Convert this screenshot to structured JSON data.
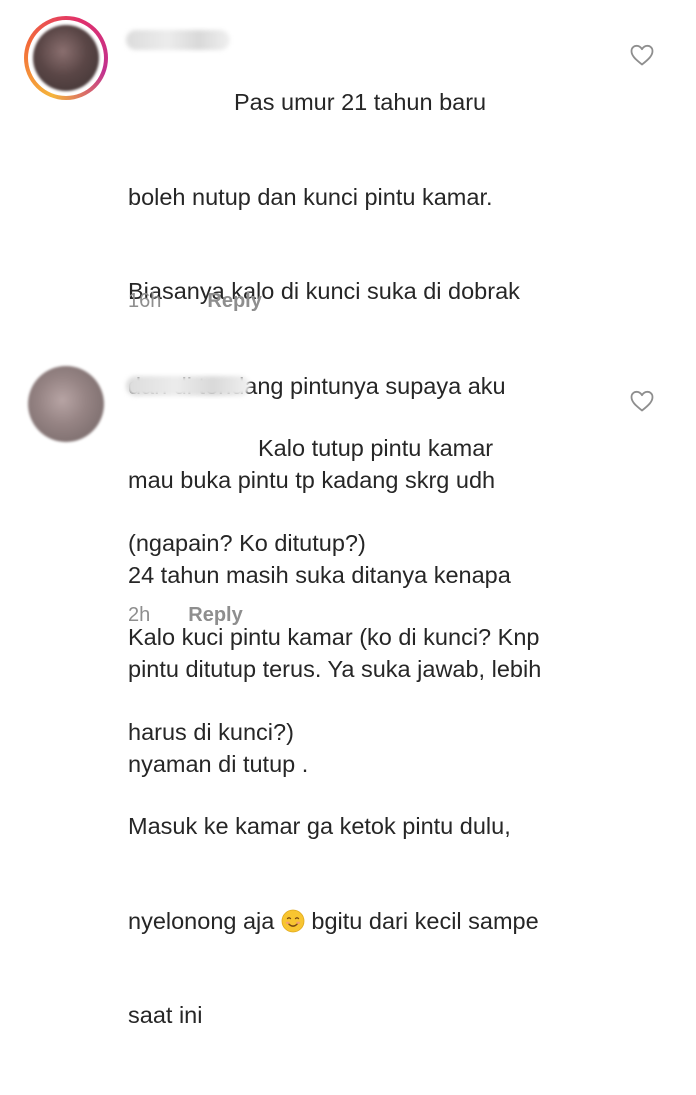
{
  "comments": [
    {
      "text_lines": [
        "Pas umur 21 tahun baru",
        "boleh nutup dan kunci pintu kamar.",
        "Biasanya kalo di kunci suka di dobrak",
        "dan di tendang pintunya supaya aku",
        "mau buka pintu tp kadang skrg udh",
        "24 tahun masih suka ditanya kenapa",
        "pintu ditutup terus. Ya suka jawab, lebih",
        "nyaman di tutup ."
      ],
      "time": "16h",
      "reply_label": "Reply",
      "like_icon": "heart-outline-icon",
      "avatar_ring": true
    },
    {
      "text_lines": [
        "Kalo tutup pintu kamar",
        "(ngapain? Ko ditutup?)",
        "Kalo kuci pintu kamar (ko di kunci? Knp",
        "harus di kunci?)",
        "Masuk ke kamar ga ketok pintu dulu,",
        "nyelonong aja",
        "bgitu dari kecil sampe",
        "saat ini"
      ],
      "emoji": "smiling-face-emoji",
      "time": "2h",
      "reply_label": "Reply",
      "like_icon": "heart-outline-icon",
      "avatar_ring": false
    }
  ],
  "colors": {
    "text": "#262626",
    "meta": "#8e8e8e",
    "ring_start": "#f5b43a",
    "ring_end": "#c1318f"
  }
}
